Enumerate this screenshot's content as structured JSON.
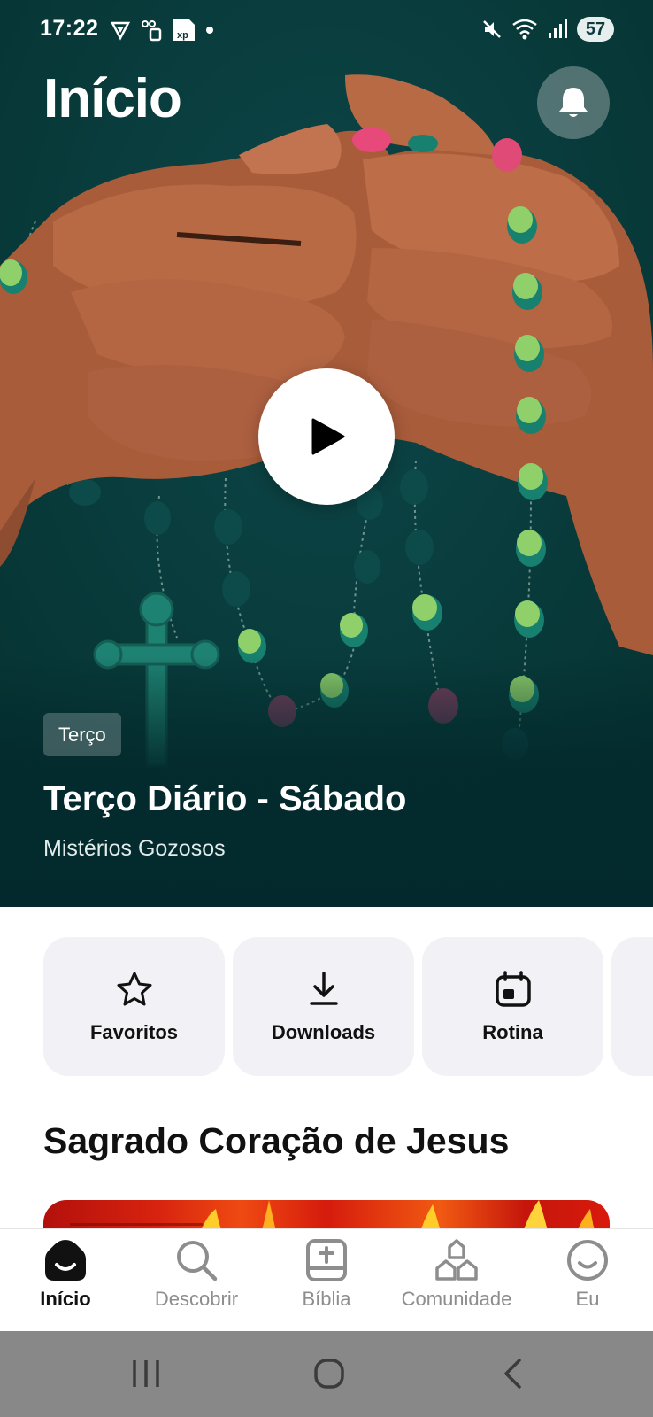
{
  "status_bar": {
    "time": "17:22",
    "battery": "57",
    "left_icons": [
      "vpn-shield-icon",
      "sim-card-icon",
      "xp-app-icon",
      "notification-dot-icon"
    ],
    "right_icons": [
      "mute-icon",
      "wifi-icon",
      "signal-icon",
      "battery-icon"
    ]
  },
  "header": {
    "title": "Início",
    "bell_icon": "bell-icon"
  },
  "hero": {
    "tag": "Terço",
    "title": "Terço Diário - Sábado",
    "subtitle": "Mistérios Gozosos",
    "play_icon": "play-icon",
    "background_color": "#083538"
  },
  "quick_actions": [
    {
      "label": "Favoritos",
      "icon": "star-icon"
    },
    {
      "label": "Downloads",
      "icon": "download-icon"
    },
    {
      "label": "Rotina",
      "icon": "calendar-icon"
    }
  ],
  "section": {
    "title": "Sagrado Coração de Jesus"
  },
  "bottom_nav": {
    "active": "Início",
    "items": [
      {
        "label": "Início",
        "icon": "home-icon"
      },
      {
        "label": "Descobrir",
        "icon": "search-icon"
      },
      {
        "label": "Bíblia",
        "icon": "bible-icon"
      },
      {
        "label": "Comunidade",
        "icon": "community-icon"
      },
      {
        "label": "Eu",
        "icon": "profile-icon"
      }
    ]
  },
  "colors": {
    "accent_dark": "#083538",
    "card_background": "#f2f1f5",
    "system_nav": "#888888"
  }
}
